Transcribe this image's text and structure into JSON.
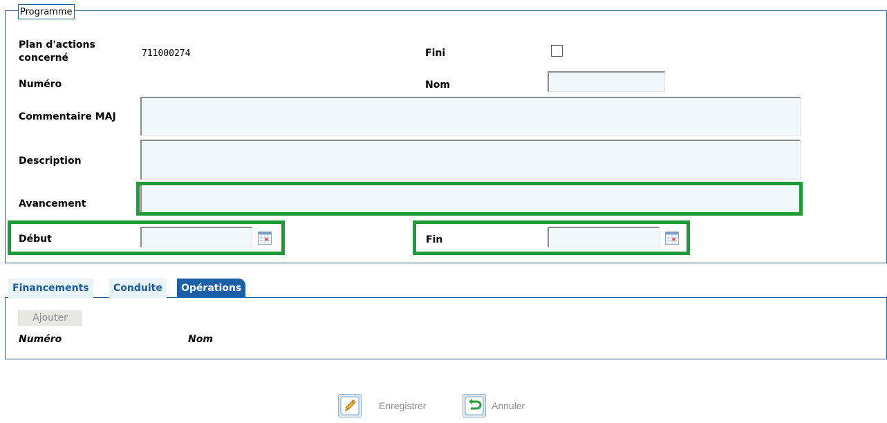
{
  "programme": {
    "legend": "Programme",
    "plan_label": "Plan d'actions concerné",
    "plan_value": "711000274",
    "fini_label": "Fini",
    "fini_checked": false,
    "numero_label": "Numéro",
    "nom_label": "Nom",
    "nom_value": "",
    "commentaire_label": "Commentaire MAJ",
    "commentaire_value": "",
    "description_label": "Description",
    "description_value": "",
    "avancement_label": "Avancement",
    "avancement_value": "",
    "debut_label": "Début",
    "debut_value": "",
    "fin_label": "Fin",
    "fin_value": ""
  },
  "tabs": [
    {
      "label": "Financements",
      "active": false
    },
    {
      "label": "Conduite",
      "active": false
    },
    {
      "label": "Opérations",
      "active": true
    }
  ],
  "operations": {
    "add_label": "Ajouter",
    "columns": [
      "Numéro",
      "Nom"
    ]
  },
  "actions": {
    "save_label": "Enregistrer",
    "cancel_label": "Annuler"
  },
  "colors": {
    "highlight": "#1e9b38",
    "tab_active": "#1b5fa8",
    "input_bg": "#f1f8fc"
  }
}
